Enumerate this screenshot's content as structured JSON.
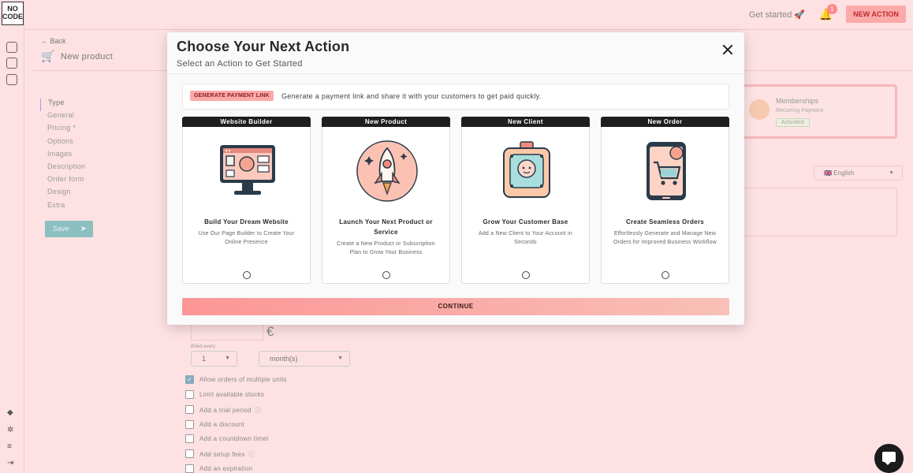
{
  "app": {
    "logo_line1": "NO",
    "logo_line2": "CODE"
  },
  "topbar": {
    "get_started": "Get started 🚀",
    "notification_count": "1",
    "new_action_label": "NEW ACTION"
  },
  "page": {
    "back_label": "← Back",
    "title": "New product",
    "nav": [
      "Type",
      "General",
      "Pricing *",
      "Options",
      "Images",
      "Description",
      "Order form",
      "Design",
      "Extra"
    ],
    "save_label": "Save",
    "membership": {
      "title": "Memberships",
      "subtitle": "Recurring Payment",
      "badge": "Activated"
    },
    "language": "🇬🇧 English",
    "currency_symbol": "€",
    "billed_every_label": "Billed every",
    "billed_every_value": "1",
    "billed_unit": "month(s)",
    "options": [
      {
        "label": "Allow orders of multiple units",
        "checked": true,
        "info": false
      },
      {
        "label": "Limit available stocks",
        "checked": false,
        "info": false
      },
      {
        "label": "Add a trial period",
        "checked": false,
        "info": true
      },
      {
        "label": "Add a discount",
        "checked": false,
        "info": false
      },
      {
        "label": "Add a countdown timer",
        "checked": false,
        "info": false
      },
      {
        "label": "Add setup fees",
        "checked": false,
        "info": true
      },
      {
        "label": "Add an expiration",
        "checked": false,
        "info": false
      }
    ]
  },
  "modal": {
    "title": "Choose Your Next Action",
    "subtitle": "Select an Action to Get Started",
    "payment_link": {
      "badge": "GENERATE PAYMENT LINK",
      "text": "Generate a payment link and share it with your customers to get paid quickly."
    },
    "cards": [
      {
        "header": "Website Builder",
        "icon": "website-builder-icon",
        "title": "Build Your Dream Website",
        "desc": "Use Our Page Builder to Create Your Online Presence"
      },
      {
        "header": "New Product",
        "icon": "rocket-icon",
        "title": "Launch Your Next Product or Service",
        "desc": "Create a New Product or Subscription Plan to Grow Your Business"
      },
      {
        "header": "New Client",
        "icon": "client-badge-icon",
        "title": "Grow Your Customer Base",
        "desc": "Add a New Client to Your Account in Seconds"
      },
      {
        "header": "New Order",
        "icon": "shopping-cart-icon",
        "title": "Create Seamless Orders",
        "desc": "Effortlessly Generate and Manage New Orders for Improved Business Workflow"
      }
    ],
    "continue_label": "CONTINUE"
  }
}
